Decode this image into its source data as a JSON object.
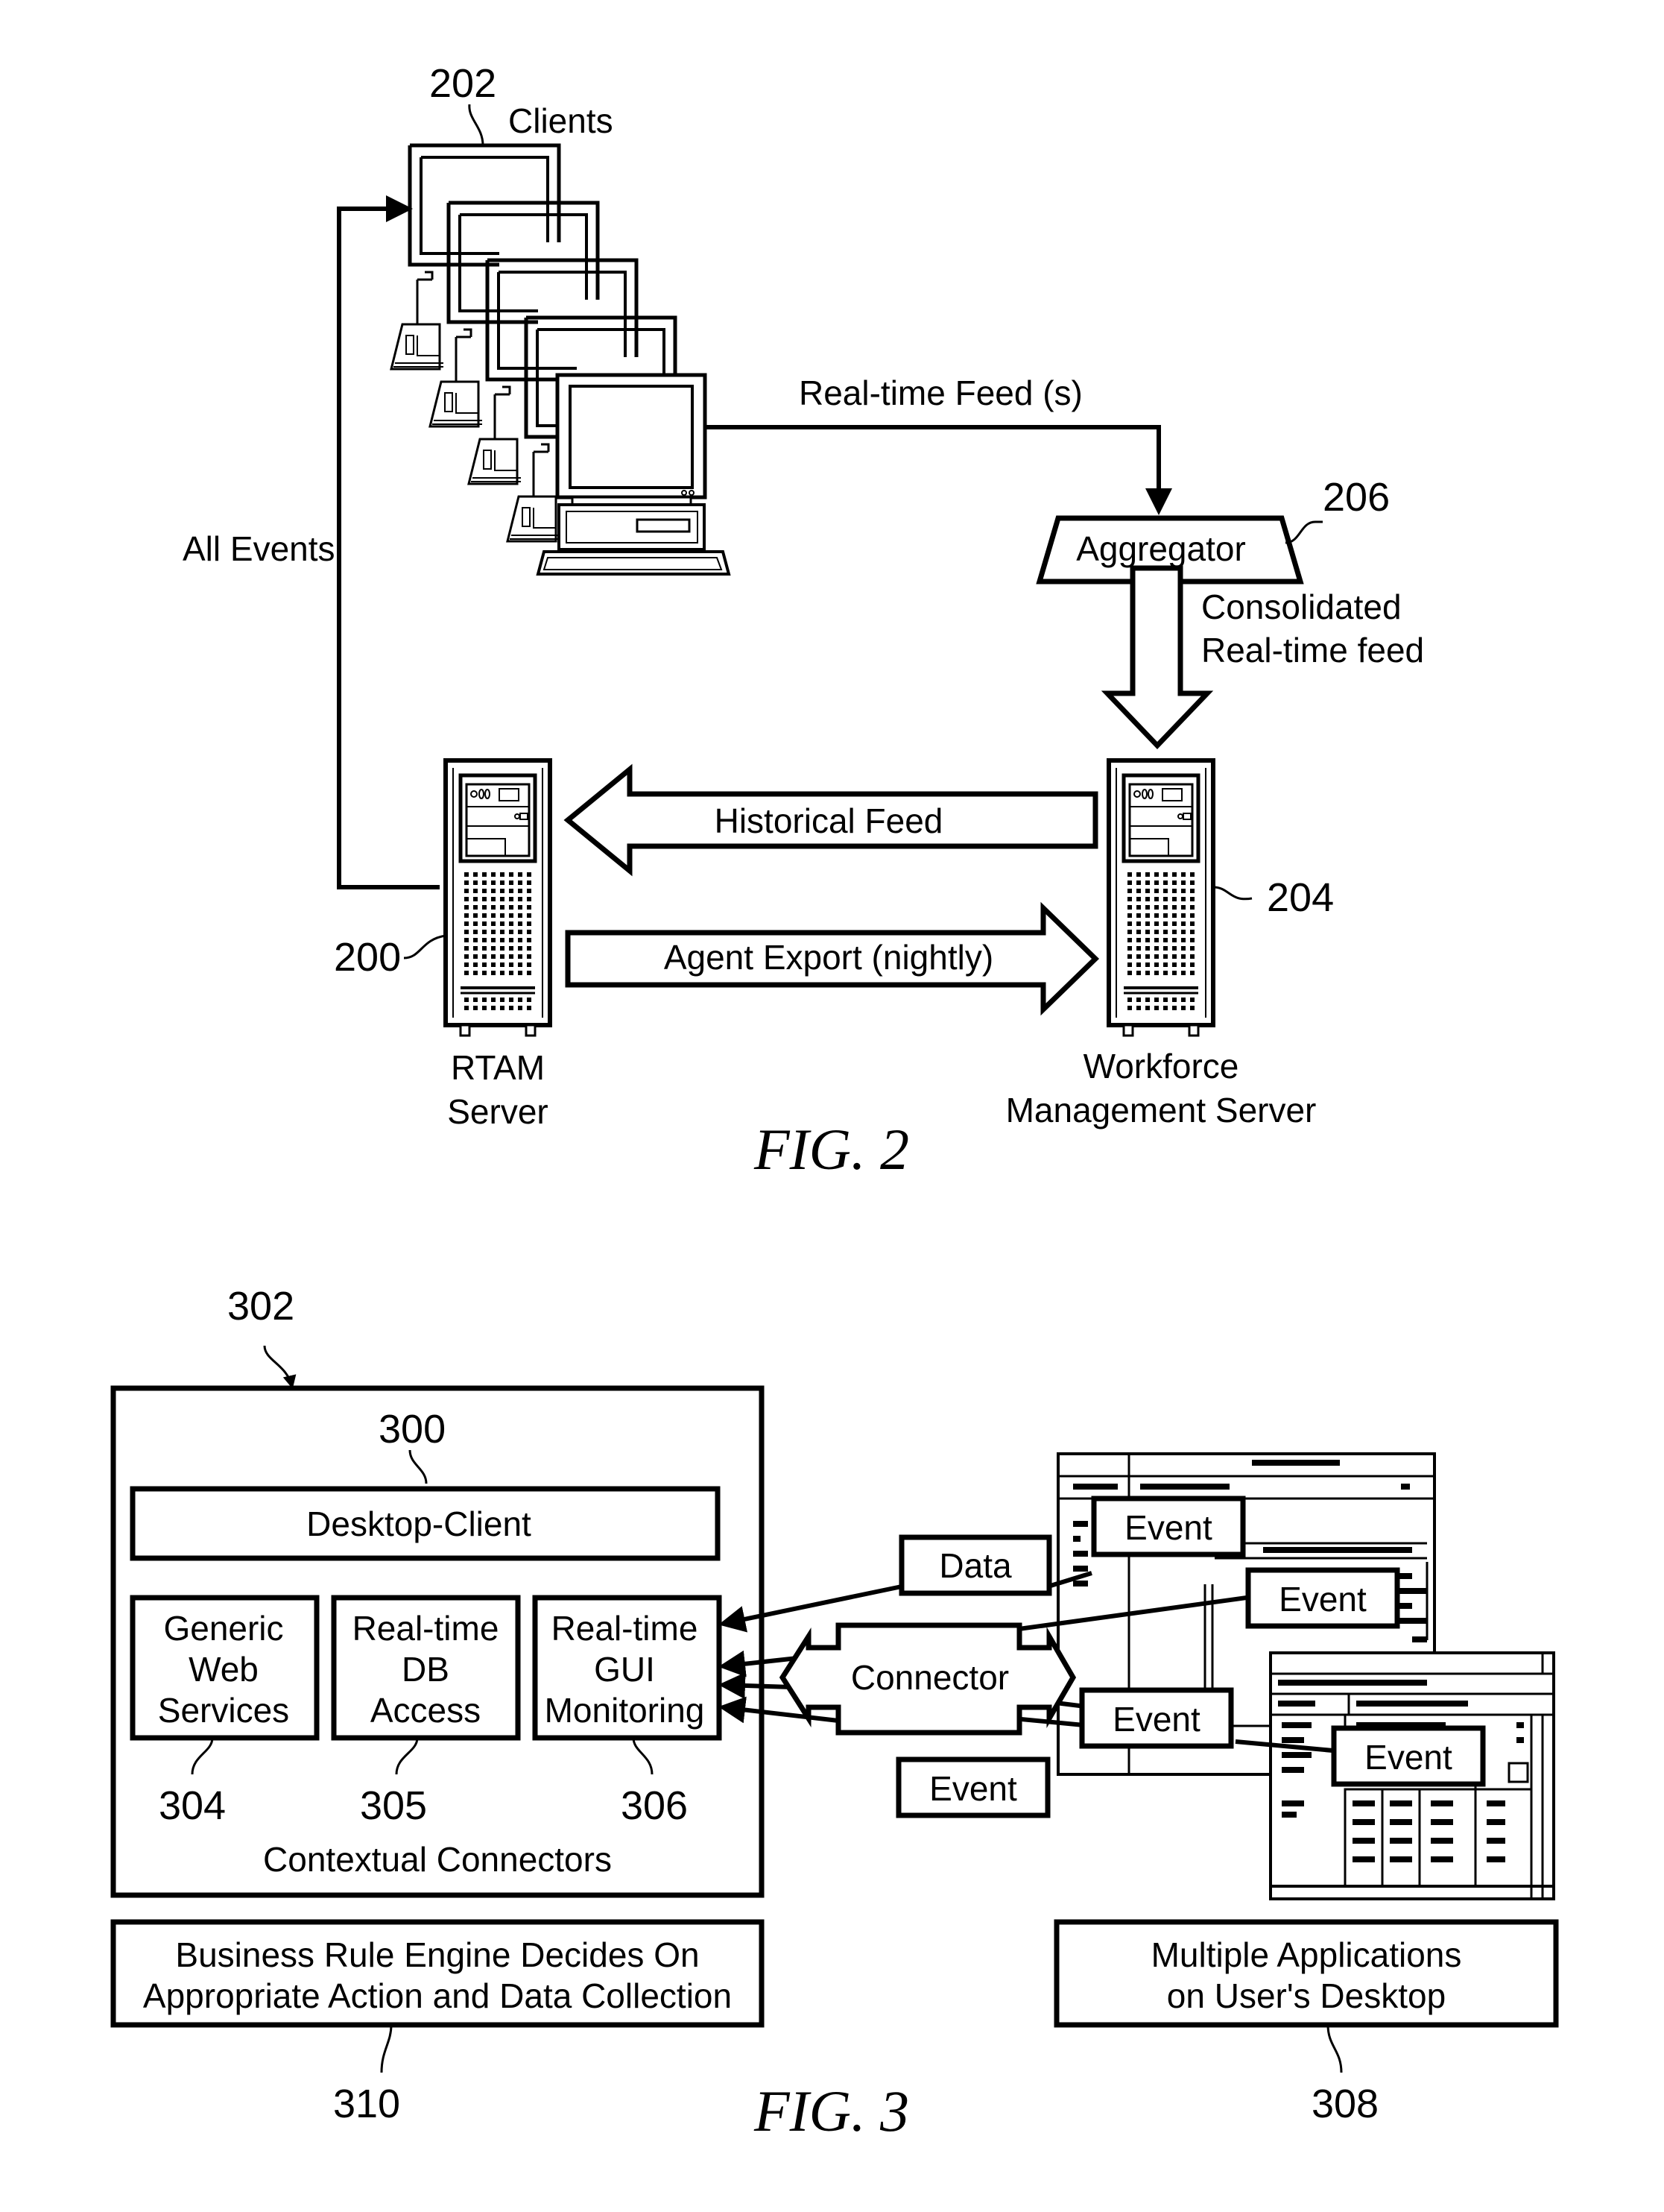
{
  "fig2": {
    "caption": "FIG. 2",
    "clients": {
      "ref": "202",
      "label": "Clients"
    },
    "aggregator": {
      "ref": "206",
      "label": "Aggregator"
    },
    "rtam_server": {
      "ref": "200",
      "label_line1": "RTAM",
      "label_line2": "Server"
    },
    "wfm_server": {
      "ref": "204",
      "label_line1": "Workforce",
      "label_line2": "Management Server"
    },
    "arrows": {
      "all_events": "All Events",
      "realtime_feeds": "Real-time Feed (s)",
      "consolidated_line1": "Consolidated",
      "consolidated_line2": "Real-time feed",
      "historical_feed": "Historical Feed",
      "agent_export": "Agent Export (nightly)"
    }
  },
  "fig3": {
    "caption": "FIG. 3",
    "outer_box_ref": "302",
    "desktop_client": {
      "ref": "300",
      "label": "Desktop-Client"
    },
    "connectors": [
      {
        "ref": "304",
        "lines": [
          "Generic",
          "Web",
          "Services"
        ]
      },
      {
        "ref": "305",
        "lines": [
          "Real-time",
          "DB",
          "Access"
        ]
      },
      {
        "ref": "306",
        "lines": [
          "Real-time",
          "GUI",
          "Monitoring"
        ]
      }
    ],
    "contextual_connectors": "Contextual Connectors",
    "connector_label": "Connector",
    "data_label": "Data",
    "event_labels": [
      "Event",
      "Event",
      "Event",
      "Event",
      "Event"
    ],
    "business_rule": {
      "ref": "310",
      "line1": "Business Rule Engine Decides On",
      "line2": "Appropriate Action and Data Collection"
    },
    "multiple_apps": {
      "ref": "308",
      "line1": "Multiple Applications",
      "line2": "on User's Desktop"
    }
  }
}
